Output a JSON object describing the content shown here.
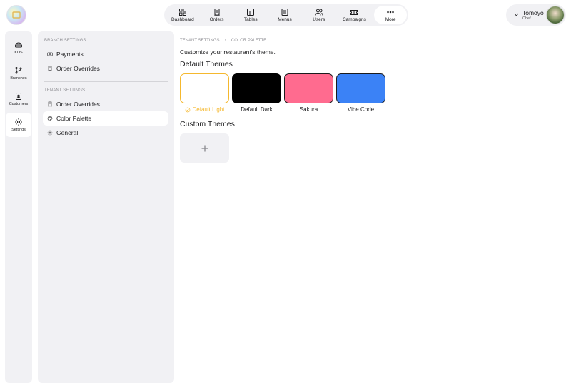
{
  "topnav": {
    "items": [
      {
        "label": "Dashboard",
        "icon": "dashboard-icon"
      },
      {
        "label": "Orders",
        "icon": "orders-icon"
      },
      {
        "label": "Tables",
        "icon": "tables-icon"
      },
      {
        "label": "Menus",
        "icon": "menus-icon"
      },
      {
        "label": "Users",
        "icon": "users-icon"
      },
      {
        "label": "Campaigns",
        "icon": "campaigns-icon"
      },
      {
        "label": "More",
        "icon": "more-icon"
      }
    ],
    "active": "More"
  },
  "user": {
    "name": "Tomoyo",
    "role": "Chef"
  },
  "rail": {
    "items": [
      {
        "label": "KDS",
        "icon": "kds-icon"
      },
      {
        "label": "Branches",
        "icon": "branches-icon"
      },
      {
        "label": "Customers",
        "icon": "customers-icon"
      },
      {
        "label": "Settings",
        "icon": "settings-icon"
      }
    ],
    "active": "Settings"
  },
  "panel": {
    "branch_title": "BRANCH SETTINGS",
    "branch_items": [
      {
        "label": "Payments",
        "icon": "payments-icon"
      },
      {
        "label": "Order Overrides",
        "icon": "order-overrides-icon"
      }
    ],
    "tenant_title": "TENANT SETTINGS",
    "tenant_items": [
      {
        "label": "Order Overrides",
        "icon": "order-overrides-icon"
      },
      {
        "label": "Color Palette",
        "icon": "palette-icon"
      },
      {
        "label": "General",
        "icon": "gear-icon"
      }
    ],
    "active": "Color Palette"
  },
  "main": {
    "breadcrumb": [
      "TENANT SETTINGS",
      "COLOR PALETTE"
    ],
    "subtitle": "Customize your restaurant's theme.",
    "default_heading": "Default Themes",
    "custom_heading": "Custom Themes",
    "themes": [
      {
        "label": "Default Light",
        "color": "#ffffff",
        "selected": true
      },
      {
        "label": "Default Dark",
        "color": "#000000",
        "selected": false
      },
      {
        "label": "Sakura",
        "color": "#ff6b8f",
        "selected": false
      },
      {
        "label": "Vibe Code",
        "color": "#3b82f6",
        "selected": false
      }
    ]
  },
  "colors": {
    "accent": "#f5b82e",
    "panel_bg": "#f1f1f4"
  }
}
